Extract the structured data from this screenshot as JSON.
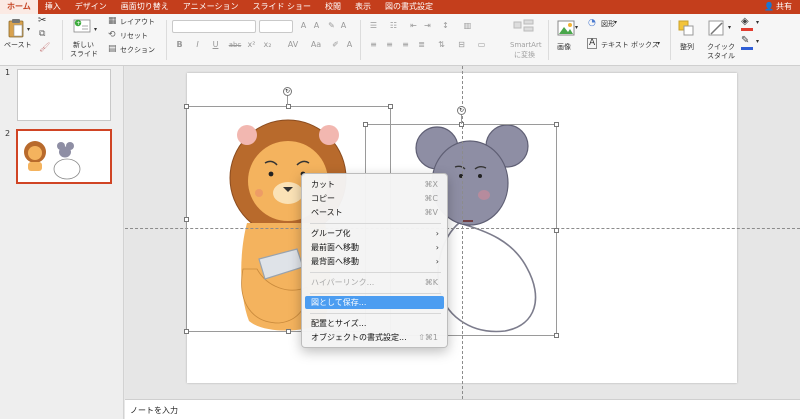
{
  "tabs": [
    {
      "label": "ホーム",
      "active": true
    },
    {
      "label": "挿入"
    },
    {
      "label": "デザイン"
    },
    {
      "label": "画面切り替え"
    },
    {
      "label": "アニメーション"
    },
    {
      "label": "スライド ショー"
    },
    {
      "label": "校閲"
    },
    {
      "label": "表示"
    },
    {
      "label": "図の書式設定"
    }
  ],
  "share_label": "共有",
  "ribbon": {
    "paste": "ペースト",
    "new_slide_line1": "新しい",
    "new_slide_line2": "スライド",
    "layout": "レイアウト",
    "reset": "リセット",
    "section": "セクション",
    "smartart_line1": "SmartArt",
    "smartart_line2": "に変換",
    "image": "画像",
    "shape": "図形",
    "textbox": "テキスト ボックス",
    "arrange": "整列",
    "quickstyle_line1": "クイック",
    "quickstyle_line2": "スタイル"
  },
  "slides": [
    {
      "number": "1"
    },
    {
      "number": "2",
      "selected": true
    }
  ],
  "notes_placeholder": "ノートを入力",
  "context_menu": {
    "items": [
      {
        "label": "カット",
        "shortcut": "⌘X"
      },
      {
        "label": "コピー",
        "shortcut": "⌘C"
      },
      {
        "label": "ペースト",
        "shortcut": "⌘V"
      },
      {
        "label": "グループ化",
        "submenu": true
      },
      {
        "label": "最前面へ移動",
        "submenu": true
      },
      {
        "label": "最背面へ移動",
        "submenu": true
      },
      {
        "label": "ハイパーリンク...",
        "shortcut": "⌘K",
        "disabled": true
      },
      {
        "label": "図として保存...",
        "highlighted": true
      },
      {
        "label": "配置とサイズ..."
      },
      {
        "label": "オブジェクトの書式設定...",
        "shortcut": "⇧⌘1"
      }
    ]
  },
  "colors": {
    "accent": "#c43e1c",
    "menu_highlight": "#4c9df1",
    "lion_mane": "#b86a2c",
    "lion_face": "#f4b35e",
    "mouse_body": "#8e8ea4"
  }
}
